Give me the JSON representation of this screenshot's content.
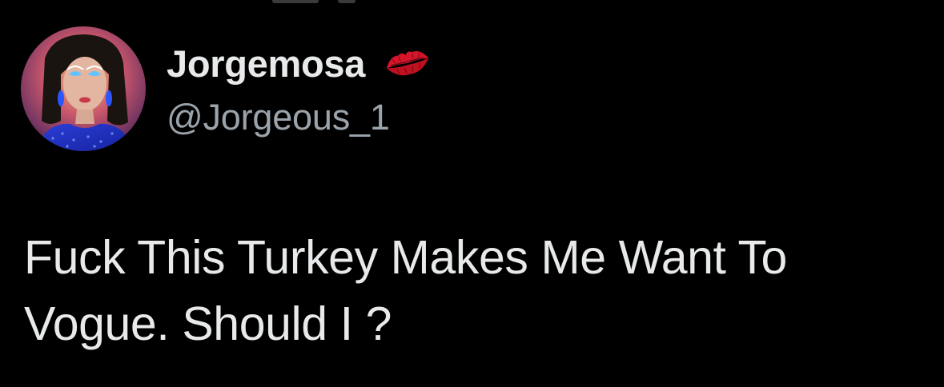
{
  "tweet": {
    "author": {
      "display_name": "Jorgemosa",
      "handle": "@Jorgeous_1",
      "badge_icon": "kiss-mark-icon",
      "avatar_icon": "profile-avatar-image"
    },
    "text": "Fuck This Turkey Makes Me Want To Vogue. Should I ?"
  },
  "colors": {
    "background": "#000000",
    "name": "#e7e9ea",
    "handle": "#9ba3ab",
    "body_text": "#e7e9ea",
    "kiss_red": "#d8142a"
  }
}
